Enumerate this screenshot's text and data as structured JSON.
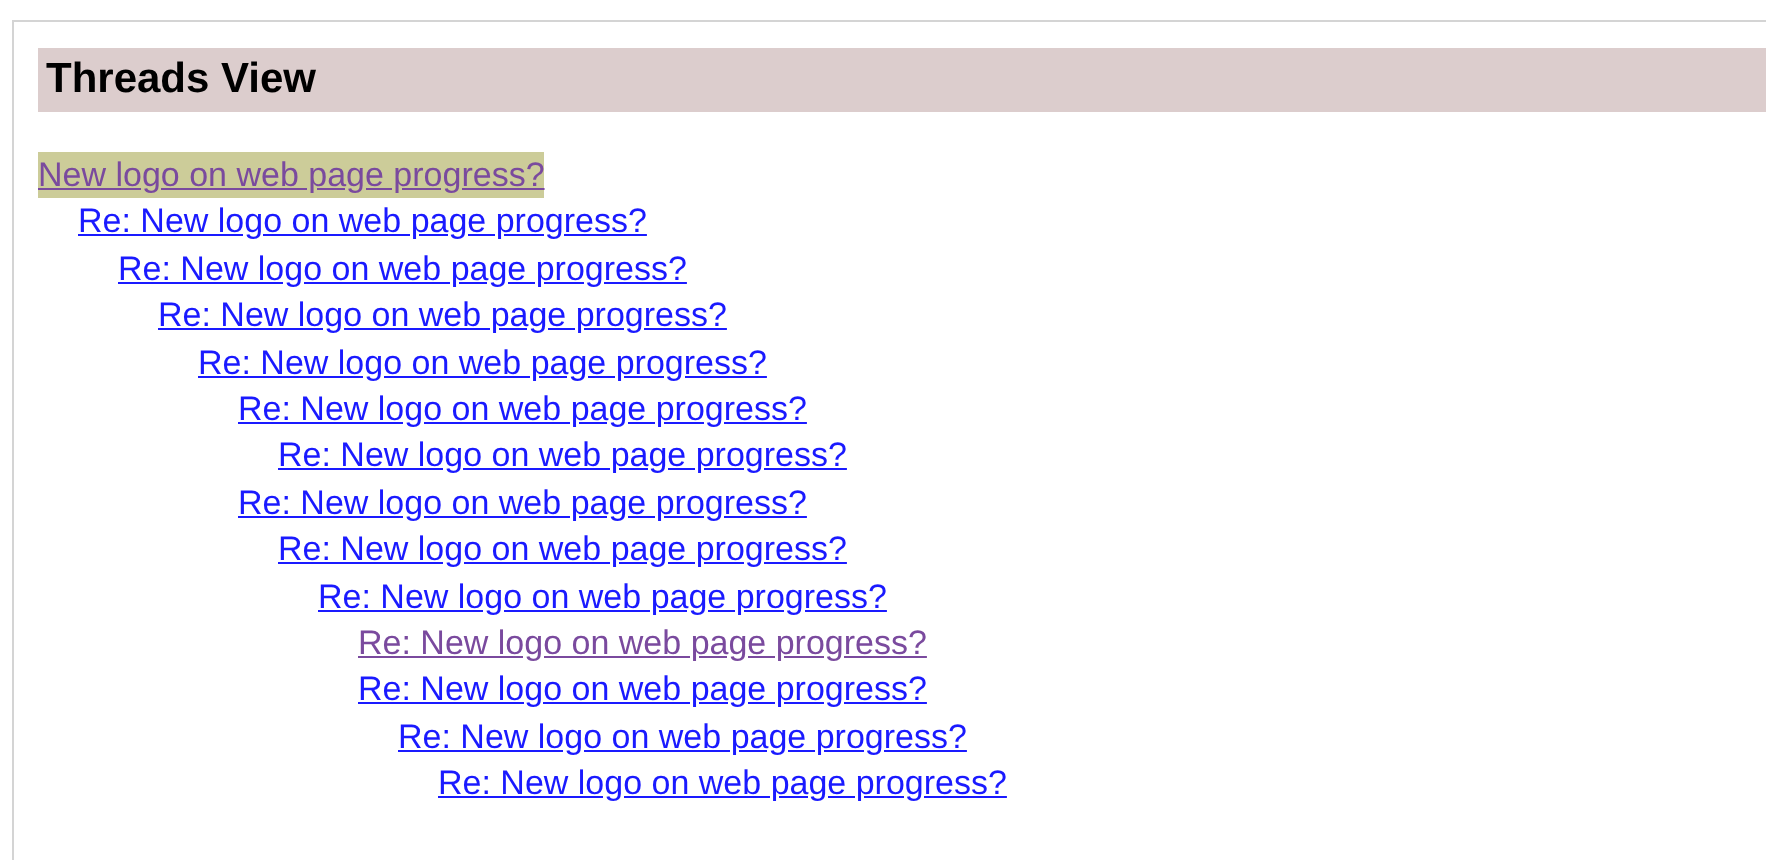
{
  "heading": "Threads View",
  "threads": [
    {
      "title": "New logo on web page progress?",
      "selected": true,
      "visited": true,
      "children": [
        {
          "title": "Re: New logo on web page progress?",
          "selected": false,
          "visited": false,
          "children": [
            {
              "title": "Re: New logo on web page progress?",
              "selected": false,
              "visited": false,
              "children": [
                {
                  "title": "Re: New logo on web page progress?",
                  "selected": false,
                  "visited": false,
                  "children": [
                    {
                      "title": "Re: New logo on web page progress?",
                      "selected": false,
                      "visited": false,
                      "children": [
                        {
                          "title": "Re: New logo on web page progress?",
                          "selected": false,
                          "visited": false,
                          "children": [
                            {
                              "title": "Re: New logo on web page progress?",
                              "selected": false,
                              "visited": false
                            }
                          ]
                        },
                        {
                          "title": "Re: New logo on web page progress?",
                          "selected": false,
                          "visited": false,
                          "children": [
                            {
                              "title": "Re: New logo on web page progress?",
                              "selected": false,
                              "visited": false,
                              "children": [
                                {
                                  "title": "Re: New logo on web page progress?",
                                  "selected": false,
                                  "visited": false,
                                  "children": [
                                    {
                                      "title": "Re: New logo on web page progress?",
                                      "selected": false,
                                      "visited": true
                                    },
                                    {
                                      "title": "Re: New logo on web page progress?",
                                      "selected": false,
                                      "visited": false,
                                      "children": [
                                        {
                                          "title": "Re: New logo on web page progress?",
                                          "selected": false,
                                          "visited": false,
                                          "children": [
                                            {
                                              "title": "Re: New logo on web page progress?",
                                              "selected": false,
                                              "visited": false
                                            }
                                          ]
                                        }
                                      ]
                                    }
                                  ]
                                }
                              ]
                            }
                          ]
                        }
                      ]
                    }
                  ]
                }
              ]
            }
          ]
        }
      ]
    }
  ]
}
